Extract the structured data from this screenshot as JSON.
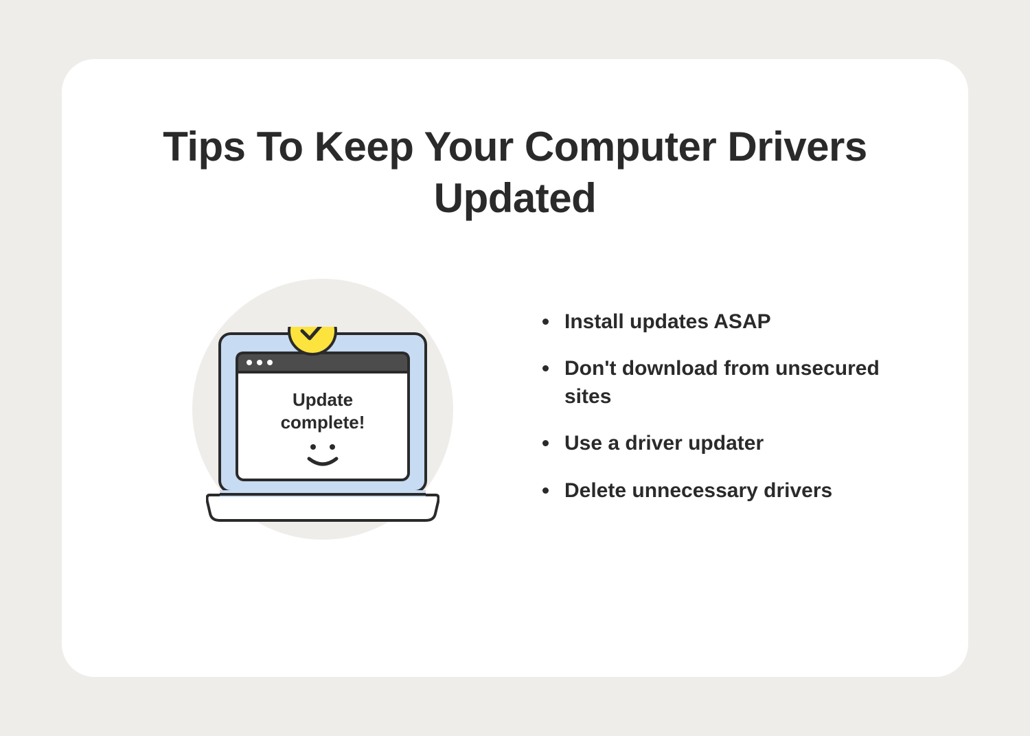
{
  "title": "Tips To Keep Your Computer Drivers Updated",
  "illustration": {
    "window_text_line1": "Update",
    "window_text_line2": "complete!"
  },
  "tips": [
    "Install updates ASAP",
    "Don't download from unsecured sites",
    "Use a driver updater",
    "Delete unnecessary drivers"
  ],
  "colors": {
    "page_bg": "#efedea",
    "card_bg": "#ffffff",
    "text": "#2a2a2a",
    "laptop_screen": "#c7dbf2",
    "window_header": "#4c4c4c",
    "accent_yellow": "#fce33d"
  }
}
